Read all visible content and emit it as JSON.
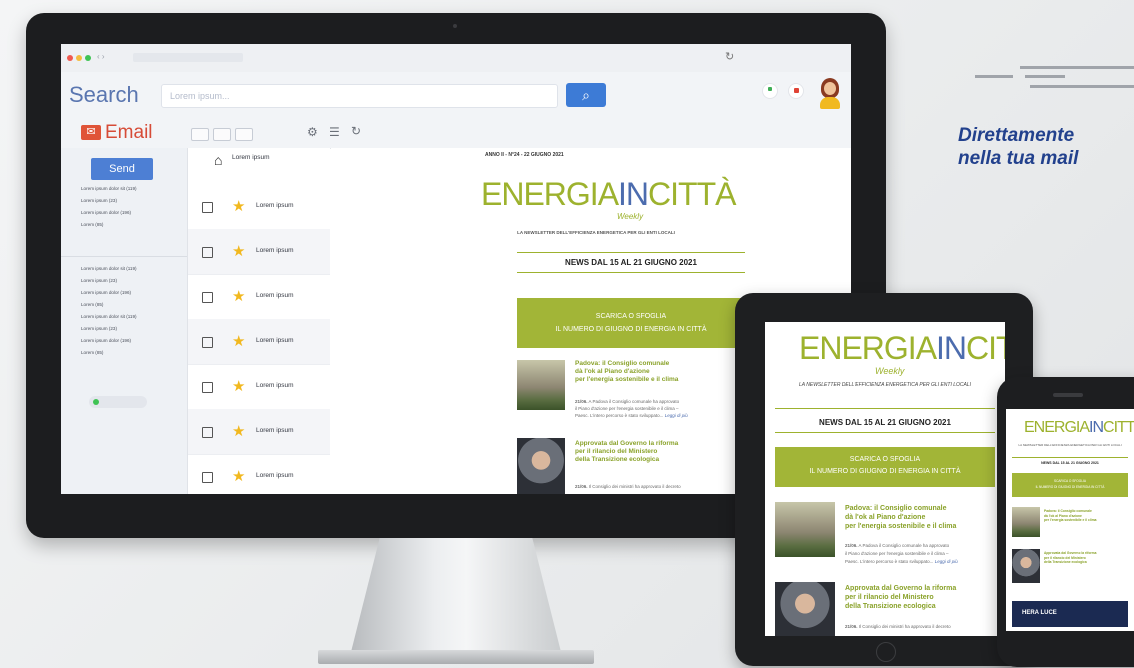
{
  "tagline": {
    "line1": "Direttamente",
    "line2": "nella tua mail"
  },
  "app": {
    "search_label": "Search",
    "search_placeholder": "Lorem ipsum...",
    "email_label": "Email",
    "send_label": "Send",
    "folder_groups": [
      [
        "Lorem ipsum dolor sit (119)",
        "Lorem ipsum (23)",
        "Lorem ipsum dolor (196)",
        "Lorem (85)"
      ],
      [
        "Lorem ipsum dolor sit (119)",
        "Lorem ipsum (23)",
        "Lorem ipsum dolor (196)",
        "Lorem (85)",
        "Lorem ipsum dolor sit (119)",
        "Lorem ipsum (23)",
        "Lorem ipsum dolor (196)",
        "Lorem (85)"
      ]
    ],
    "inbox_header": "Lorem ipsum",
    "messages": [
      "Lorem ipsum",
      "Lorem ipsum",
      "Lorem ipsum",
      "Lorem ipsum",
      "Lorem ipsum",
      "Lorem ipsum",
      "Lorem ipsum"
    ]
  },
  "newsletter": {
    "issue": "ANNO II - N°24 - 22 GIUGNO 2021",
    "logo_energia": "ENERGIA",
    "logo_in": "IN",
    "logo_citta": "CITTÀ",
    "weekly": "Weekly",
    "subtitle": "LA NEWSLETTER DELL'EFFICIENZA ENERGETICA PER GLI ENTI LOCALI",
    "news_range": "NEWS DAL 15 AL 21 GIUGNO 2021",
    "cta_line1": "SCARICA O SFOGLIA",
    "cta_line2": "IL NUMERO DI GIUGNO DI ENERGIA IN CITTÀ",
    "articles": [
      {
        "title_l1": "Padova: il Consiglio comunale",
        "title_l2": "dà l'ok al Piano d'azione",
        "title_l3": "per l'energia sostenibile e il clima",
        "date": "21/06.",
        "excerpt_l1": "A Padova il Consiglio comunale ha approvato",
        "excerpt_l2": "il Piano d'azione per l'energia sostenibile e il clima –",
        "excerpt_l3": "Paesc. L'intero percorso è stato sviluppato...",
        "read_more": "Leggi di più"
      },
      {
        "title_l1": "Approvata dal Governo la riforma",
        "title_l2": "per il rilancio del Ministero",
        "title_l3": "della Transizione ecologica",
        "date": "21/06.",
        "excerpt_l1": "Il Consiglio dei ministri ha approvato il decreto"
      }
    ],
    "sponsor": "HERA LUCE"
  },
  "colors": {
    "brand_green": "#9db22e",
    "cta_green": "#a2b537",
    "search_blue": "#3d7bd6",
    "email_red": "#d64b37",
    "star": "#f1b81f"
  }
}
